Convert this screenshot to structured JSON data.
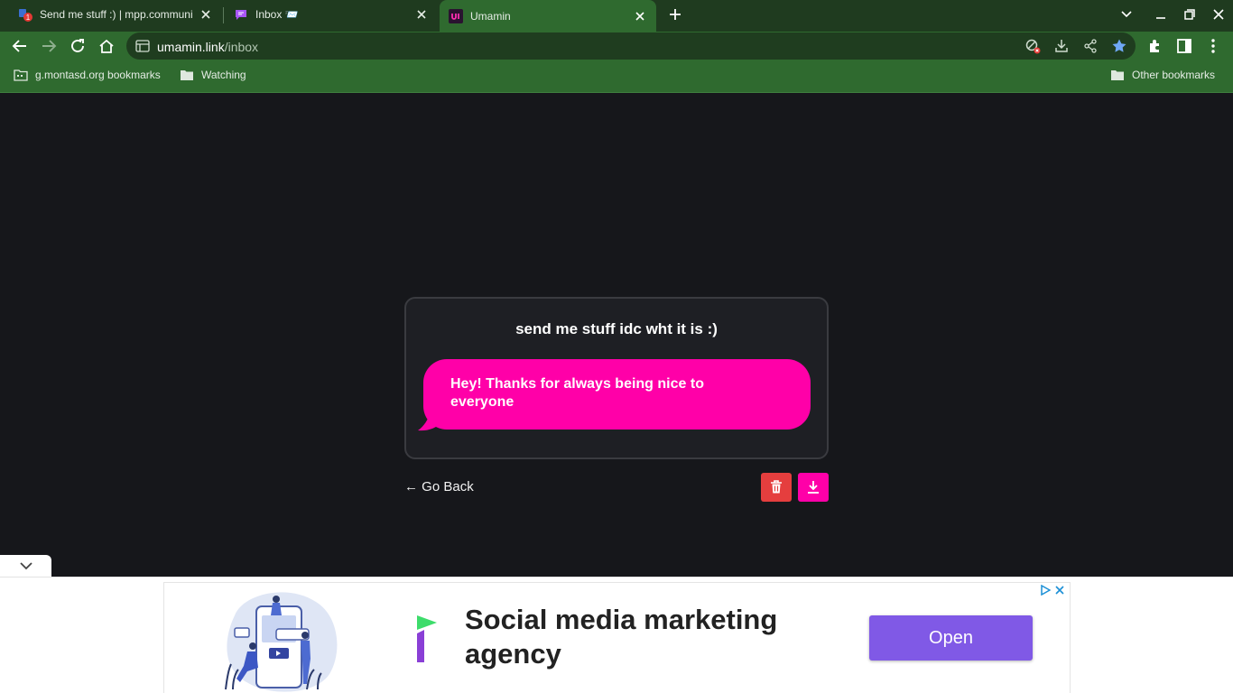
{
  "browser": {
    "tabs": [
      {
        "title": "Send me stuff :) | mpp.communi",
        "favicon": "mpp-favicon-icon",
        "badge": "1"
      },
      {
        "title": "Inbox 📨",
        "favicon": "chat-bubble-icon"
      },
      {
        "title": "Umamin",
        "favicon": "umamin-logo-icon",
        "active": true
      }
    ],
    "address": {
      "domain": "umamin.link",
      "path": "/inbox"
    },
    "bookmarks": [
      {
        "label": "g.montasd.org bookmarks",
        "icon": "folder-grid-icon"
      },
      {
        "label": "Watching",
        "icon": "folder-icon"
      }
    ],
    "other_bookmarks": "Other bookmarks",
    "accent_color": "#2f6a2f"
  },
  "message": {
    "title": "send me stuff idc wht it is :)",
    "text": "Hey! Thanks for always being nice to everyone",
    "bubble_color": "#ff00a8"
  },
  "actions": {
    "go_back": "← Go Back",
    "delete_color": "#e53e3e",
    "download_color": "#ff00a8"
  },
  "ad": {
    "headline": "Social media marketing agency",
    "cta": "Open",
    "cta_color": "#8059e6"
  }
}
